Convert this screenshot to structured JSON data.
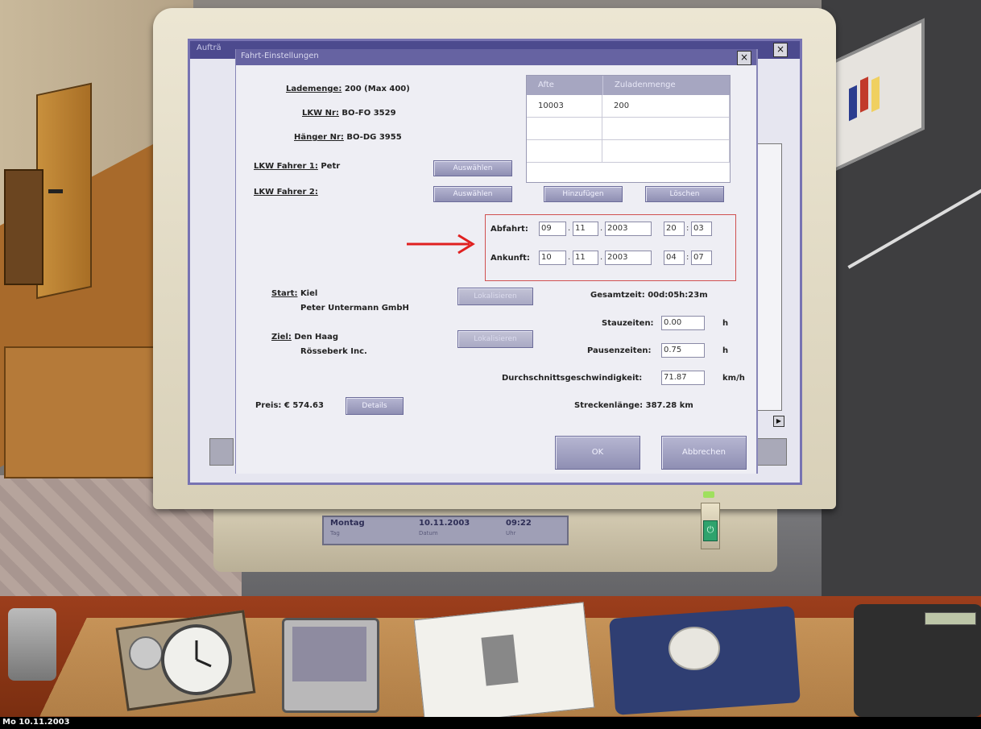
{
  "background_window": {
    "title": "Aufträ",
    "close_symbol": "×"
  },
  "dialog": {
    "title": "Fahrt-Einstellungen",
    "close_symbol": "×",
    "lademenge_label": "Lademenge:",
    "lademenge_value": "200  (Max 400)",
    "lkw_nr_label": "LKW Nr:",
    "lkw_nr_value": "BO-FO 3529",
    "haenger_nr_label": "Hänger Nr:",
    "haenger_nr_value": "BO-DG 3955",
    "fahrer1_label": "LKW Fahrer 1:",
    "fahrer1_value": "Petr",
    "fahrer2_label": "LKW Fahrer 2:",
    "fahrer2_value": "",
    "auswaehlen1": "Auswählen",
    "auswaehlen2": "Auswählen",
    "hinzufuegen": "Hinzufügen",
    "loeschen": "Löschen",
    "table": {
      "headers": [
        "Afte",
        "Zuladenmenge"
      ],
      "rows": [
        [
          "10003",
          "200"
        ],
        [
          "",
          ""
        ],
        [
          "",
          ""
        ]
      ]
    },
    "abfahrt_label": "Abfahrt:",
    "abfahrt": {
      "day": "09",
      "month": "11",
      "year": "2003",
      "hour": "20",
      "minute": "03"
    },
    "ankunft_label": "Ankunft:",
    "ankunft": {
      "day": "10",
      "month": "11",
      "year": "2003",
      "hour": "04",
      "minute": "07"
    },
    "date_sep": ".",
    "time_sep": ":",
    "start_label": "Start:",
    "start_city": "Kiel",
    "start_company": "Peter Untermann GmbH",
    "ziel_label": "Ziel:",
    "ziel_city": "Den Haag",
    "ziel_company": "Rösseberk Inc.",
    "lokalisieren1": "Lokalisieren",
    "lokalisieren2": "Lokalisieren",
    "gesamtzeit_label": "Gesamtzeit:",
    "gesamtzeit_value": "00d:05h:23m",
    "stauzeiten_label": "Stauzeiten:",
    "stauzeiten_value": "0.00",
    "pausenzeiten_label": "Pausenzeiten:",
    "pausenzeiten_value": "0.75",
    "hours_unit": "h",
    "durchschnitt_label": "Durchschnittsgeschwindigkeit:",
    "durchschnitt_value": "71.87",
    "speed_unit": "km/h",
    "preis_label": "Preis: € 574.63",
    "details": "Details",
    "streckenlaenge_label": "Streckenlänge:",
    "streckenlaenge_value": "387.28 km",
    "ok": "OK",
    "abbrechen": "Abbrechen"
  },
  "monitor_lcd": {
    "day": "Montag",
    "day_sub": "Tag",
    "date": "10.11.2003",
    "date_sub": "Datum",
    "time": "09:22",
    "time_sub": "Uhr",
    "power_symbol": "⏻"
  },
  "status_bar": {
    "text": "Mo 10.11.2003"
  },
  "colors": {
    "dialog_titlebar": "#6663a2",
    "annotation_red": "#e02020",
    "power_green": "#2fa36d"
  }
}
